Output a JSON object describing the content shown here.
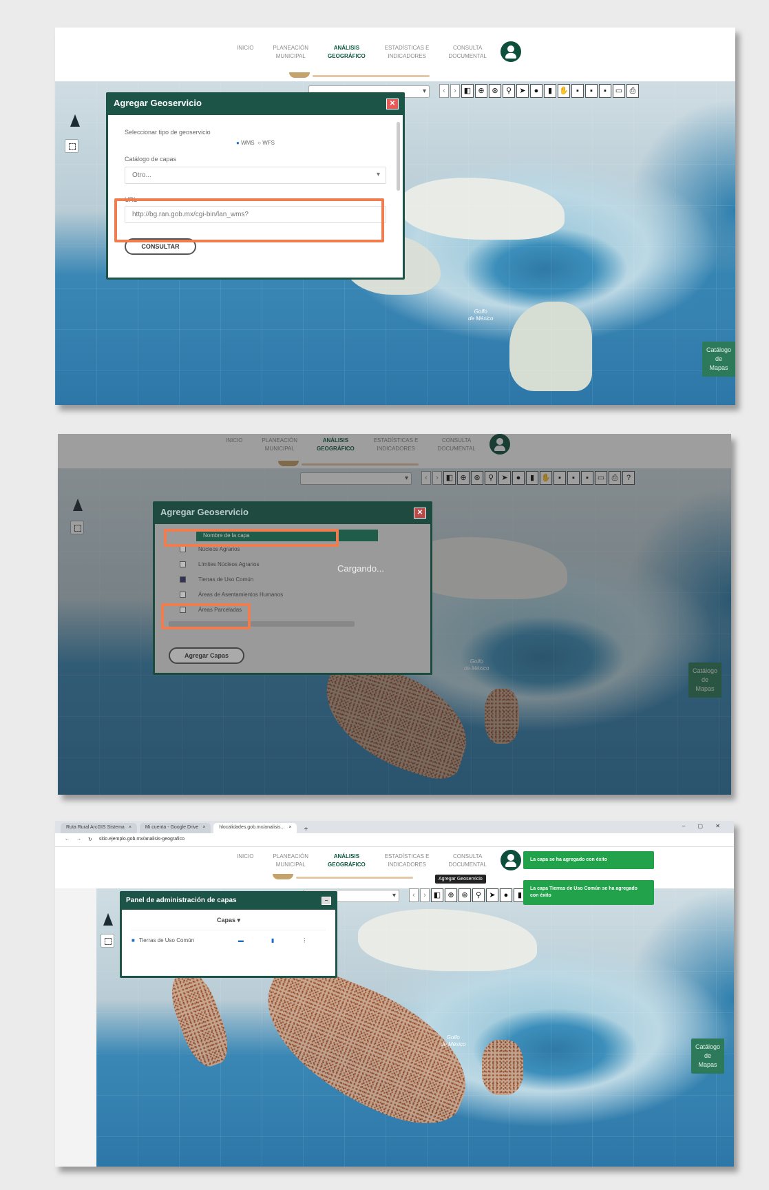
{
  "nav": {
    "items": [
      "INICIO",
      "PLANEACIÓN\nMUNICIPAL",
      "ANÁLISIS\nGEOGRÁFICO",
      "ESTADÍSTICAS E\nINDICADORES",
      "CONSULTA\nDOCUMENTAL"
    ],
    "active_index": 2
  },
  "map": {
    "gulf_label": "Golfo\nde México",
    "catalog_button": "Catálogo\nde\nMapas"
  },
  "colors": {
    "dialog_header": "#1c5548",
    "highlight": "#ef7d4f",
    "toast": "#22a24a",
    "catalog_button": "#2c7a5a"
  },
  "shot1": {
    "dialog_title": "Agregar Geoservicio",
    "service_type_label": "Seleccionar tipo de geoservicio",
    "option_wms": "WMS",
    "option_wfs": "WFS",
    "selected_option": "WMS",
    "catalog_label": "Catálogo de capas",
    "catalog_value": "Otro...",
    "url_label": "URL",
    "url_value": "http://bg.ran.gob.mx/cgi-bin/lan_wms?",
    "consult_button": "CONSULTAR"
  },
  "shot2": {
    "dialog_title": "Agregar Geoservicio",
    "layers_header": "Nombre de la capa",
    "layers": [
      {
        "name": "Núcleos Agrarios",
        "checked": false,
        "highlighted": false
      },
      {
        "name": "Límites Núcleos Agrarios",
        "checked": false,
        "highlighted": false
      },
      {
        "name": "Tierras de Uso Común",
        "checked": true,
        "highlighted": true
      },
      {
        "name": "Áreas de Asentamientos Humanos",
        "checked": false,
        "highlighted": false
      },
      {
        "name": "Áreas Parceladas",
        "checked": false,
        "highlighted": false
      }
    ],
    "loading_text": "Cargando...",
    "add_layers_button": "Agregar Capas"
  },
  "shot3": {
    "browser_tabs": [
      "Ruta Rural ArcGIS Sistema",
      "Mi cuenta - Google Drive",
      "hlocalidades.gob.mx/analisis..."
    ],
    "address": "sitio.ejemplo.gob.mx/analisis-geografico",
    "panel_title": "Panel de administración de capas",
    "layers_dropdown": "Capas",
    "layer_row": "Tierras de Uso Común",
    "tooltip": "Agregar Geoservicio",
    "toast1": "La capa se ha agregado con éxito",
    "toast2": "La capa Tierras de Uso Común se ha agregado con éxito"
  }
}
